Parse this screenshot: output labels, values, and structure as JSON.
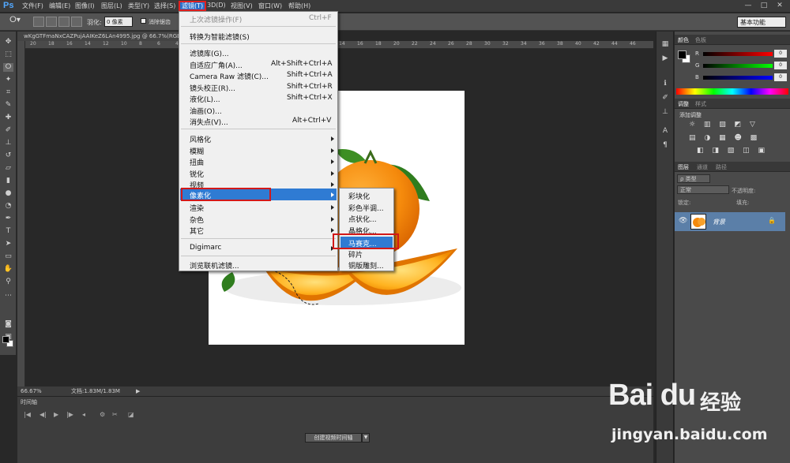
{
  "app": {
    "logo": "Ps"
  },
  "menubar": {
    "items": [
      "文件(F)",
      "编辑(E)",
      "图像(I)",
      "图层(L)",
      "类型(Y)",
      "选择(S)",
      "滤镜(T)",
      "3D(D)",
      "视图(V)",
      "窗口(W)",
      "帮助(H)"
    ],
    "active_index": 6
  },
  "window_controls": [
    "—",
    "□",
    "✕"
  ],
  "options": {
    "feather_label": "羽化:",
    "feather_value": "0 像素",
    "antialias_label": "消除锯齿",
    "workspace": "基本功能"
  },
  "document": {
    "tab_title": "wKgGTFmaNxCAZPujAAIKeZ6LAn4995.jpg @ 66.7%(RGB/8)",
    "zoom": "66.67%",
    "doc_info": "文档:1.83M/1.83M",
    "ruler_marks": [
      "20",
      "18",
      "16",
      "14",
      "12",
      "10",
      "8",
      "6",
      "4",
      "2",
      "0",
      "2",
      "4",
      "6",
      "8",
      "10",
      "12",
      "14",
      "16",
      "18",
      "20",
      "22",
      "24",
      "26",
      "28",
      "30",
      "32",
      "34",
      "36",
      "38",
      "40",
      "42",
      "44",
      "46"
    ]
  },
  "timeline": {
    "tab": "时间轴",
    "create_button": "创建视频时间轴"
  },
  "filter_menu": {
    "last_filter": "上次滤镜操作(F)",
    "last_filter_shortcut": "Ctrl+F",
    "smart": "转换为智能滤镜(S)",
    "gallery": "滤镜库(G)...",
    "adaptive_wide": "自适应广角(A)...",
    "adaptive_wide_shortcut": "Alt+Shift+Ctrl+A",
    "camera_raw": "Camera Raw 滤镜(C)...",
    "camera_raw_shortcut": "Shift+Ctrl+A",
    "lens": "镜头校正(R)...",
    "lens_shortcut": "Shift+Ctrl+R",
    "liquify": "液化(L)...",
    "liquify_shortcut": "Shift+Ctrl+X",
    "oil": "油画(O)...",
    "vanish": "消失点(V)...",
    "vanish_shortcut": "Alt+Ctrl+V",
    "stylize": "风格化",
    "blur": "模糊",
    "distort": "扭曲",
    "sharpen": "锐化",
    "video": "视频",
    "pixelate": "像素化",
    "render": "渲染",
    "noise": "杂色",
    "other": "其它",
    "digimarc": "Digimarc",
    "browse": "浏览联机滤镜..."
  },
  "pixelate_submenu": {
    "items": [
      "彩块化",
      "彩色半调...",
      "点状化...",
      "晶格化...",
      "马赛克...",
      "碎片",
      "铜版雕刻..."
    ],
    "highlight_index": 4
  },
  "color_panel": {
    "tabs": [
      "颜色",
      "色板"
    ],
    "channels": [
      "R",
      "G",
      "B"
    ],
    "values": [
      "0",
      "0",
      "0"
    ]
  },
  "adjust_panel": {
    "tabs": [
      "调整",
      "样式"
    ],
    "title": "添加调整",
    "icons_row1": "☼ ▥ ▨ ◩ ▽",
    "icons_row2": "▤ ◑ ▦ ☻ ▩",
    "icons_row3": "◧ ◨ ▧ ◫ ▣"
  },
  "layers_panel": {
    "tabs": [
      "图层",
      "通道",
      "路径"
    ],
    "kind": "ρ 类型",
    "blend": "正常",
    "opacity_label": "不透明度:",
    "lock_label": "锁定:",
    "fill_label": "填充:",
    "layer_name": "背景"
  },
  "watermark": {
    "logo": "Bai du",
    "cn": "经验",
    "url": "jingyan.baidu.com"
  },
  "colors": {
    "accent": "#2f7bd3",
    "highlight_box": "#d21818",
    "ui_dark": "#282828"
  }
}
